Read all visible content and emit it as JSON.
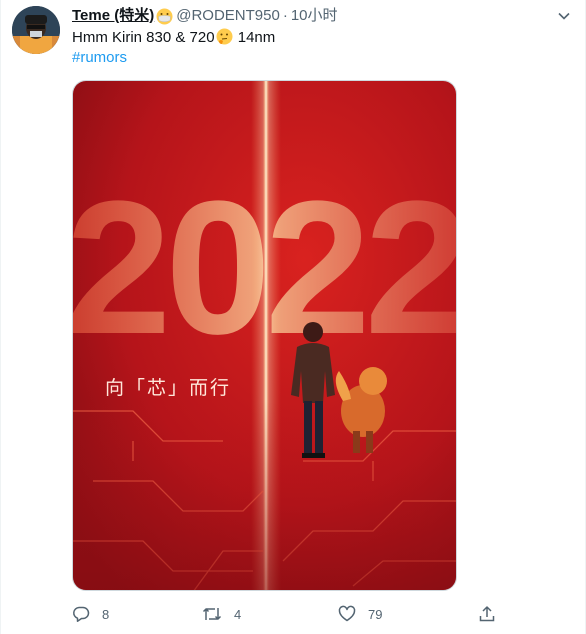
{
  "tweet": {
    "display_name": "Teme (特米)",
    "handle": "@RODENT950",
    "separator": "·",
    "time": "10小时",
    "text_before_emoji": "Hmm Kirin 830 & 720",
    "text_after_emoji": " 14nm",
    "hashtag": "#rumors"
  },
  "media": {
    "year": "2022",
    "slogan": "向「芯」而行",
    "colors": {
      "background": "#b5141a",
      "glow": "#ffd9a8"
    }
  },
  "actions": {
    "reply_count": "8",
    "retweet_count": "4",
    "like_count": "79"
  },
  "icons": {
    "avatar": "avatar",
    "mask_emoji": "face-with-medical-mask-emoji",
    "thinking_emoji": "thinking-face-emoji",
    "more": "chevron-down-icon",
    "reply": "reply-icon",
    "retweet": "retweet-icon",
    "like": "heart-icon",
    "share": "share-icon"
  },
  "colors": {
    "link": "#1d9bf0",
    "secondary_text": "#536471",
    "primary_text": "#0f1419"
  }
}
